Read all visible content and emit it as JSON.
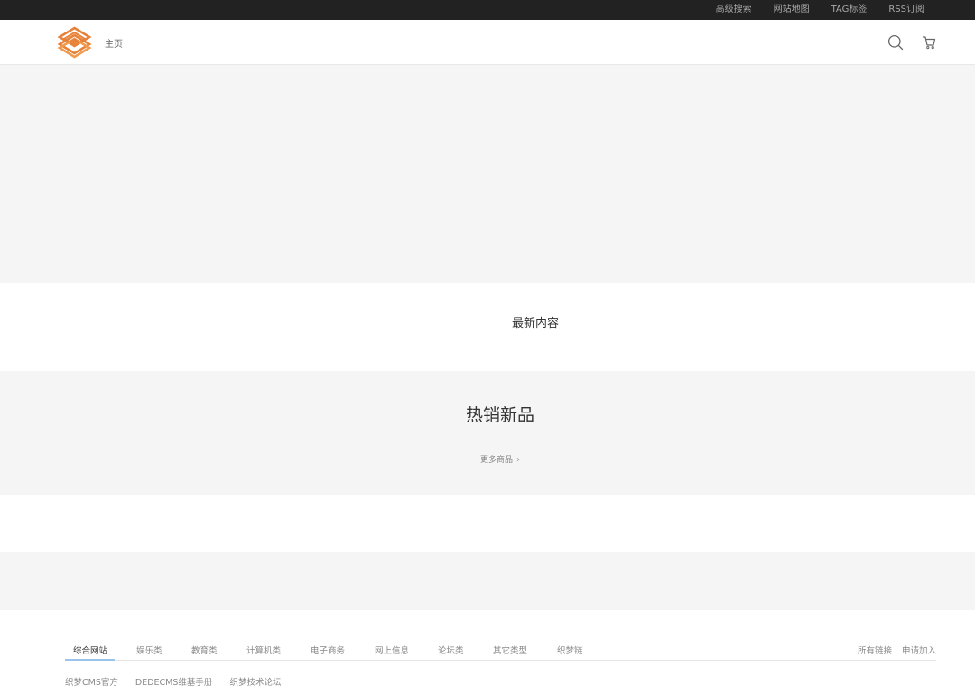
{
  "topbar": {
    "links": [
      "高级搜索",
      "网站地图",
      "TAG标签",
      "RSS订阅"
    ]
  },
  "header": {
    "nav_home": "主页",
    "brand_color": "#e8823a"
  },
  "sections": {
    "latest_title": "最新内容",
    "hot_title": "热销新品",
    "more_goods": "更多商品"
  },
  "links": {
    "tabs": [
      "综合网站",
      "娱乐类",
      "教育类",
      "计算机类",
      "电子商务",
      "网上信息",
      "论坛类",
      "其它类型",
      "织梦链"
    ],
    "active_tab": "综合网站",
    "right": [
      "所有链接",
      "申请加入"
    ],
    "friends": [
      "织梦CMS官方",
      "DEDECMS维基手册",
      "织梦技术论坛"
    ]
  }
}
